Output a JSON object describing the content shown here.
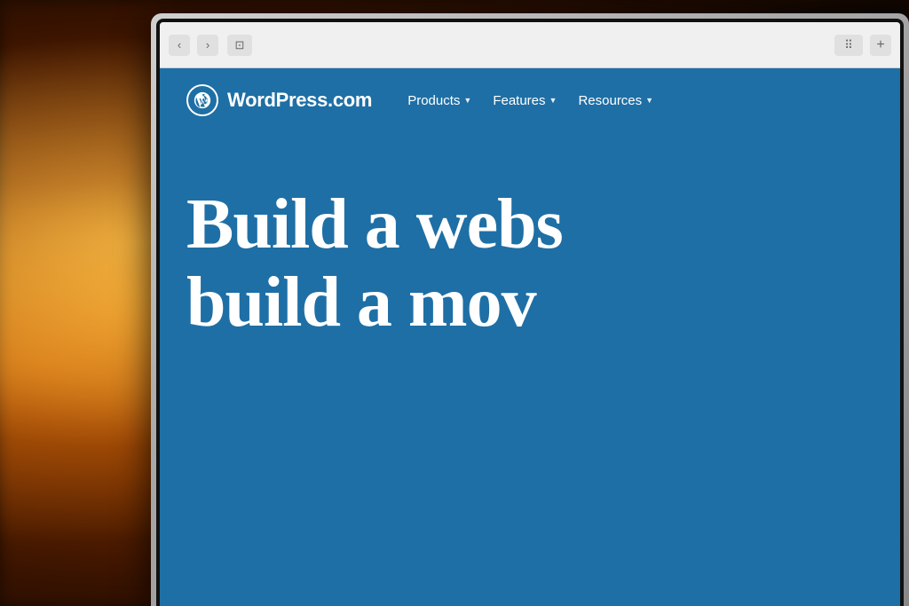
{
  "background": {
    "description": "Blurred warm bokeh background with orange/amber tones"
  },
  "browser": {
    "back_button_label": "‹",
    "forward_button_label": "›",
    "sidebar_button_label": "⊡",
    "grid_button_label": "⠿",
    "new_tab_button_label": "+"
  },
  "wordpress_site": {
    "logo_text": "WordPress.com",
    "logo_icon": "W",
    "nav_items": [
      {
        "label": "Products",
        "has_dropdown": true
      },
      {
        "label": "Features",
        "has_dropdown": true
      },
      {
        "label": "Resources",
        "has_dropdown": true
      }
    ],
    "hero_line1": "Build a webs",
    "hero_line2": "build a mov"
  }
}
